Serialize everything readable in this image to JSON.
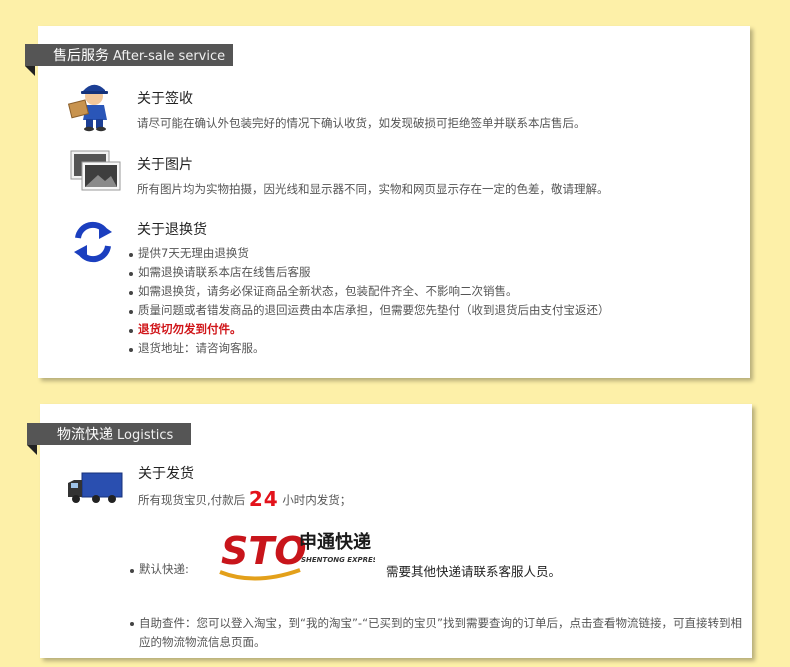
{
  "aftersale": {
    "title_cn": "售后服务",
    "title_en": "After-sale service",
    "sign": {
      "title": "关于签收",
      "desc": "请尽可能在确认外包装完好的情况下确认收货，如发现破损可拒绝签单并联系本店售后。"
    },
    "photo": {
      "title": "关于图片",
      "desc": "所有图片均为实物拍摄，因光线和显示器不同，实物和网页显示存在一定的色差，敬请理解。"
    },
    "returns": {
      "title": "关于退换货",
      "items": [
        "提供7天无理由退换货",
        "如需退换请联系本店在线售后客服",
        "如需退换货，请务必保证商品全新状态，包装配件齐全、不影响二次销售。",
        "质量问题或者错发商品的退回运费由本店承担，但需要您先垫付（收到退货后由支付宝返还）",
        "退货切勿发到付件。",
        "退货地址：请咨询客服。"
      ]
    }
  },
  "logistics": {
    "title_cn": "物流快递",
    "title_en": "Logistics",
    "ship": {
      "title": "关于发货",
      "desc_before": "所有现货宝贝,付款后",
      "hours": "24",
      "desc_after": "小时内发货；"
    },
    "courier": {
      "label": "默认快递:",
      "logo_text": "STO",
      "logo_cn": "申通快递",
      "logo_en": "SHENTONG EXPRESS",
      "note": "需要其他快递请联系客服人员。"
    },
    "self_query": "自助查件：您可以登入淘宝，到“我的淘宝”-“已买到的宝贝”找到需要查询的订单后，点击查看物流链接，可直接转到相应的物流物流信息页面。"
  },
  "colors": {
    "background": "#fdf0a8",
    "ribbon": "#555555",
    "highlight_red": "#d0161a",
    "refresh_blue": "#1b3fbf"
  }
}
